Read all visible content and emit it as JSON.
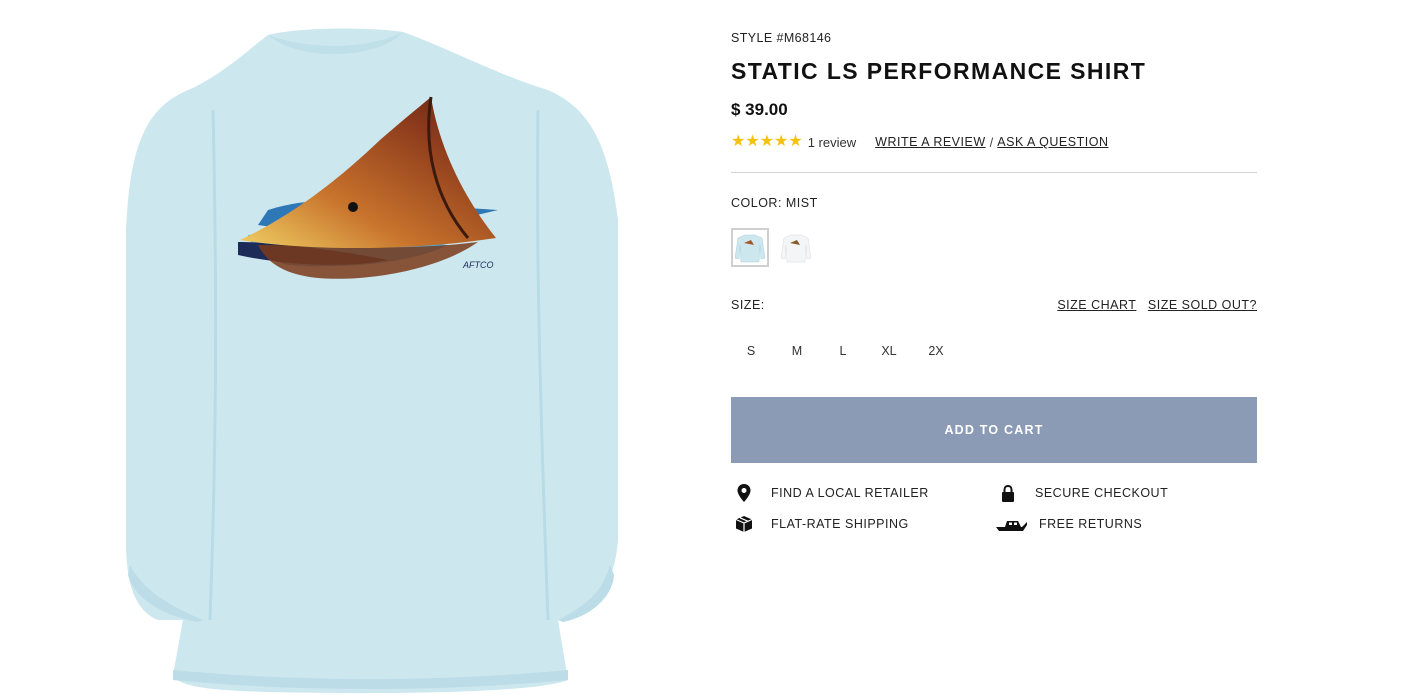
{
  "product": {
    "style_number": "STYLE #M68146",
    "title": "STATIC LS PERFORMANCE SHIRT",
    "price": "$ 39.00",
    "rating_stars": "★★★★★",
    "rating_value": 5,
    "review_count": "1 review",
    "write_review_label": "WRITE A REVIEW",
    "separator": "/",
    "ask_question_label": "ASK A QUESTION"
  },
  "color": {
    "label": "COLOR: MIST",
    "swatches": [
      {
        "name": "Mist",
        "hex": "#cfe9f0",
        "selected": true
      },
      {
        "name": "White",
        "hex": "#f4f5f6",
        "selected": false
      }
    ]
  },
  "size": {
    "label": "SIZE:",
    "size_chart_label": "SIZE CHART",
    "sold_out_label": "SIZE SOLD OUT?",
    "options": [
      "S",
      "M",
      "L",
      "XL",
      "2X"
    ]
  },
  "cart": {
    "add_label": "ADD TO CART",
    "color": "#8b9ab5"
  },
  "features": {
    "retailer": {
      "label": "FIND A LOCAL RETAILER",
      "icon": "map-pin-icon"
    },
    "checkout": {
      "label": "SECURE CHECKOUT",
      "icon": "lock-icon"
    },
    "shipping": {
      "label": "FLAT-RATE SHIPPING",
      "icon": "box-icon"
    },
    "returns": {
      "label": "FREE RETURNS",
      "icon": "boat-icon"
    }
  },
  "colors": {
    "shirt": "#cde7ef",
    "text": "#111111",
    "stars": "#f3c10e"
  }
}
